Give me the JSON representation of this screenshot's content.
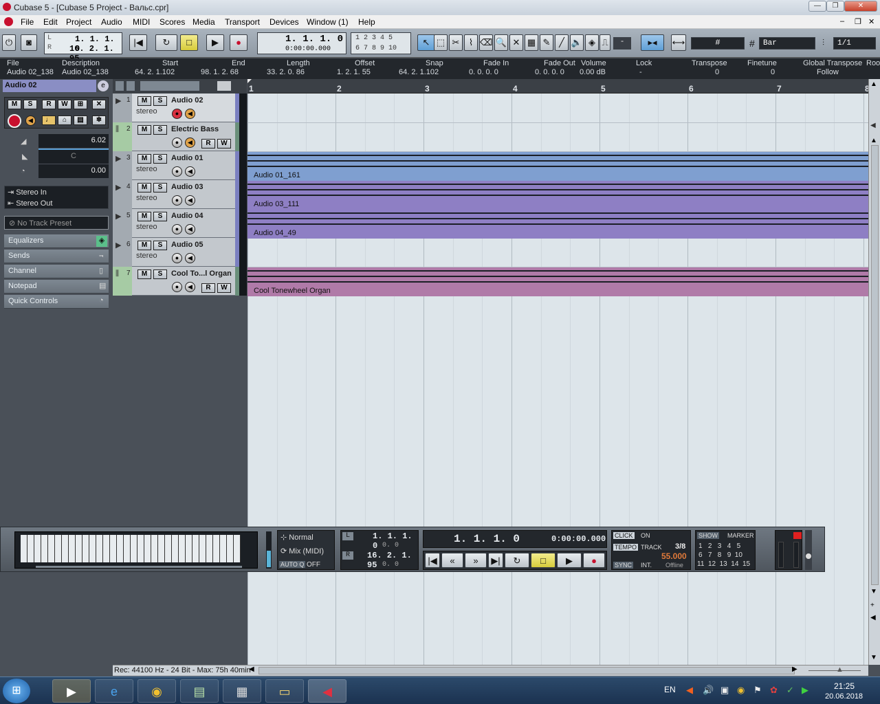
{
  "window": {
    "title": "Cubase 5 - [Cubase 5 Project - Вальс.cpr]",
    "min": "—",
    "max": "❐",
    "close": "✕"
  },
  "menu": [
    "File",
    "Edit",
    "Project",
    "Audio",
    "MIDI",
    "Scores",
    "Media",
    "Transport",
    "Devices",
    "Window (1)",
    "Help"
  ],
  "toolbar": {
    "left_locator": "1.  1.  1.   0",
    "right_locator": "16.  2.  1.  95",
    "position_bars": "1.  1.  1.     0",
    "position_time": "0:00:00.000",
    "markers_row1": "1  2  3  4  5",
    "markers_row2": "6  7  8  9  10",
    "grid_type": "Bar",
    "quantize": "1/1",
    "snap_mode": "-"
  },
  "infoline": {
    "headers": [
      "File",
      "Description",
      "Start",
      "End",
      "Length",
      "Offset",
      "Snap",
      "Fade In",
      "Fade Out",
      "Volume",
      "Lock",
      "Transpose",
      "Finetune",
      "Global Transpose",
      "Roo"
    ],
    "values": [
      "Audio 02_138",
      "Audio 02_138",
      "64.  2.  1.102",
      "98.  1.  2.  68",
      "33.  2.  0.  86",
      "1.  2.  1.  55",
      "64.  2.  1.102",
      "0.  0.  0.    0",
      "0.  0.  0.    0",
      "0.00 dB",
      "-",
      "0",
      "0",
      "Follow",
      ""
    ]
  },
  "inspector": {
    "track_name": "Audio 02",
    "volume": "6.02",
    "pan": "C",
    "delay": "0.00",
    "input": "Stereo In",
    "output": "Stereo Out",
    "preset": "No Track Preset",
    "sections": [
      "Equalizers",
      "Sends",
      "Channel",
      "Notepad",
      "Quick Controls"
    ]
  },
  "tracks": [
    {
      "num": "1",
      "name": "Audio 02",
      "sub": "stereo",
      "color": "#7a7fc0"
    },
    {
      "num": "2",
      "name": "Electric Bass",
      "sub": "",
      "color": "#6a8f7a"
    },
    {
      "num": "3",
      "name": "Audio 01",
      "sub": "stereo",
      "color": "#7a7fc0"
    },
    {
      "num": "4",
      "name": "Audio 03",
      "sub": "stereo",
      "color": "#7a7fc0"
    },
    {
      "num": "5",
      "name": "Audio 04",
      "sub": "stereo",
      "color": "#7a7fc0"
    },
    {
      "num": "6",
      "name": "Audio 05",
      "sub": "stereo",
      "color": "#7a7fc0"
    },
    {
      "num": "7",
      "name": "Cool To...l Organ",
      "sub": "",
      "color": "#6a8f7a"
    }
  ],
  "ruler_ticks": [
    "1",
    "2",
    "3",
    "4",
    "5",
    "6",
    "7",
    "8"
  ],
  "events": [
    {
      "label": "Audio 01_161",
      "color": "#7f9fd0"
    },
    {
      "label": "Audio 03_111",
      "color": "#8e7fc4"
    },
    {
      "label": "Audio 04_49",
      "color": "#8e7fc4"
    },
    {
      "label": "Cool Tonewheel Organ",
      "color": "#b07aa8"
    }
  ],
  "status": {
    "rec": "Rec: 44100 Hz - 24 Bit - Max: 75h 40min"
  },
  "transport": {
    "mode1": "Normal",
    "mode2": "Mix (MIDI)",
    "autoq": "AUTO Q",
    "autoq_state": "OFF",
    "left_loc": "1.  1.  1.   0",
    "left_sub": "0.   0",
    "right_loc": "16.  2.  1.  95",
    "right_sub": "0.   0",
    "pos_bars": "1.  1.  1.    0",
    "pos_time": "0:00:00.000",
    "click": "CLICK",
    "click_state": "ON",
    "tempo": "TEMPO",
    "track": "TRACK",
    "signature": "3/8",
    "bpm": "55.000",
    "sync": "SYNC",
    "int": "INT.",
    "offline": "Offline",
    "show": "SHOW",
    "marker": "MARKER",
    "marker_rows": [
      "1   2   3   4   5",
      "6   7   8   9  10",
      "11  12  13  14  15"
    ]
  },
  "taskbar": {
    "lang": "EN",
    "time": "21:25",
    "date": "20.06.2018"
  }
}
